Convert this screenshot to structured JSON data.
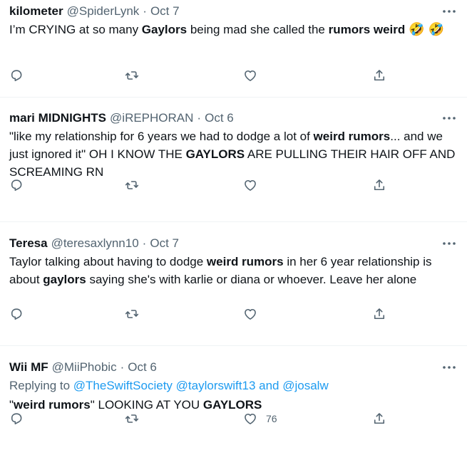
{
  "tweets": [
    {
      "name": "kilometer",
      "handle": "@SpiderLynk",
      "date": "Oct 7",
      "body_parts": [
        {
          "text": "I’m CRYING at so many ",
          "bold": false
        },
        {
          "text": "Gaylors",
          "bold": true
        },
        {
          "text": " being mad she called the ",
          "bold": false
        },
        {
          "text": "rumors weird",
          "bold": true
        },
        {
          "text": " 🤣 🤣",
          "bold": false
        }
      ],
      "like_count": ""
    },
    {
      "name": "mari MIDNIGHTS",
      "handle": "@iREPHORAN",
      "date": "Oct 6",
      "body_parts": [
        {
          "text": "\"like my relationship for 6 years we had to dodge a lot of ",
          "bold": false
        },
        {
          "text": "weird rumors",
          "bold": true
        },
        {
          "text": "... and we just ignored it\" OH I KNOW THE ",
          "bold": false
        },
        {
          "text": "GAYLORS",
          "bold": true
        },
        {
          "text": " ARE PULLING THEIR HAIR OFF AND SCREAMING RN",
          "bold": false
        }
      ],
      "like_count": ""
    },
    {
      "name": "Teresa",
      "handle": "@teresaxlynn10",
      "date": "Oct 7",
      "body_parts": [
        {
          "text": "Taylor talking about having to dodge ",
          "bold": false
        },
        {
          "text": "weird rumors",
          "bold": true
        },
        {
          "text": " in her 6 year relationship is about ",
          "bold": false
        },
        {
          "text": "gaylors",
          "bold": true
        },
        {
          "text": " saying she's with karlie or diana or whoever. Leave her alone",
          "bold": false
        }
      ],
      "like_count": ""
    },
    {
      "name": "Wii MF",
      "handle": "@MiiPhobic",
      "date": "Oct 6",
      "reply": {
        "prefix": "Replying to ",
        "mention1": "@TheSwiftSociety",
        "mention2": "@taylorswift13",
        "joiner": " and ",
        "mention3": "@josalw"
      },
      "body_parts": [
        {
          "text": "\"",
          "bold": false
        },
        {
          "text": "weird rumors",
          "bold": true
        },
        {
          "text": "\" LOOKING AT YOU ",
          "bold": false
        },
        {
          "text": "GAYLORS",
          "bold": true
        }
      ],
      "like_count": "76"
    }
  ],
  "dot": "·",
  "icons": {
    "more": "more-icon",
    "reply": "reply-icon",
    "retweet": "retweet-icon",
    "like": "like-icon",
    "share": "share-icon"
  },
  "colors": {
    "text": "#0f1419",
    "secondary": "#536471",
    "link": "#1d9bf0",
    "divider": "#eff3f4"
  }
}
